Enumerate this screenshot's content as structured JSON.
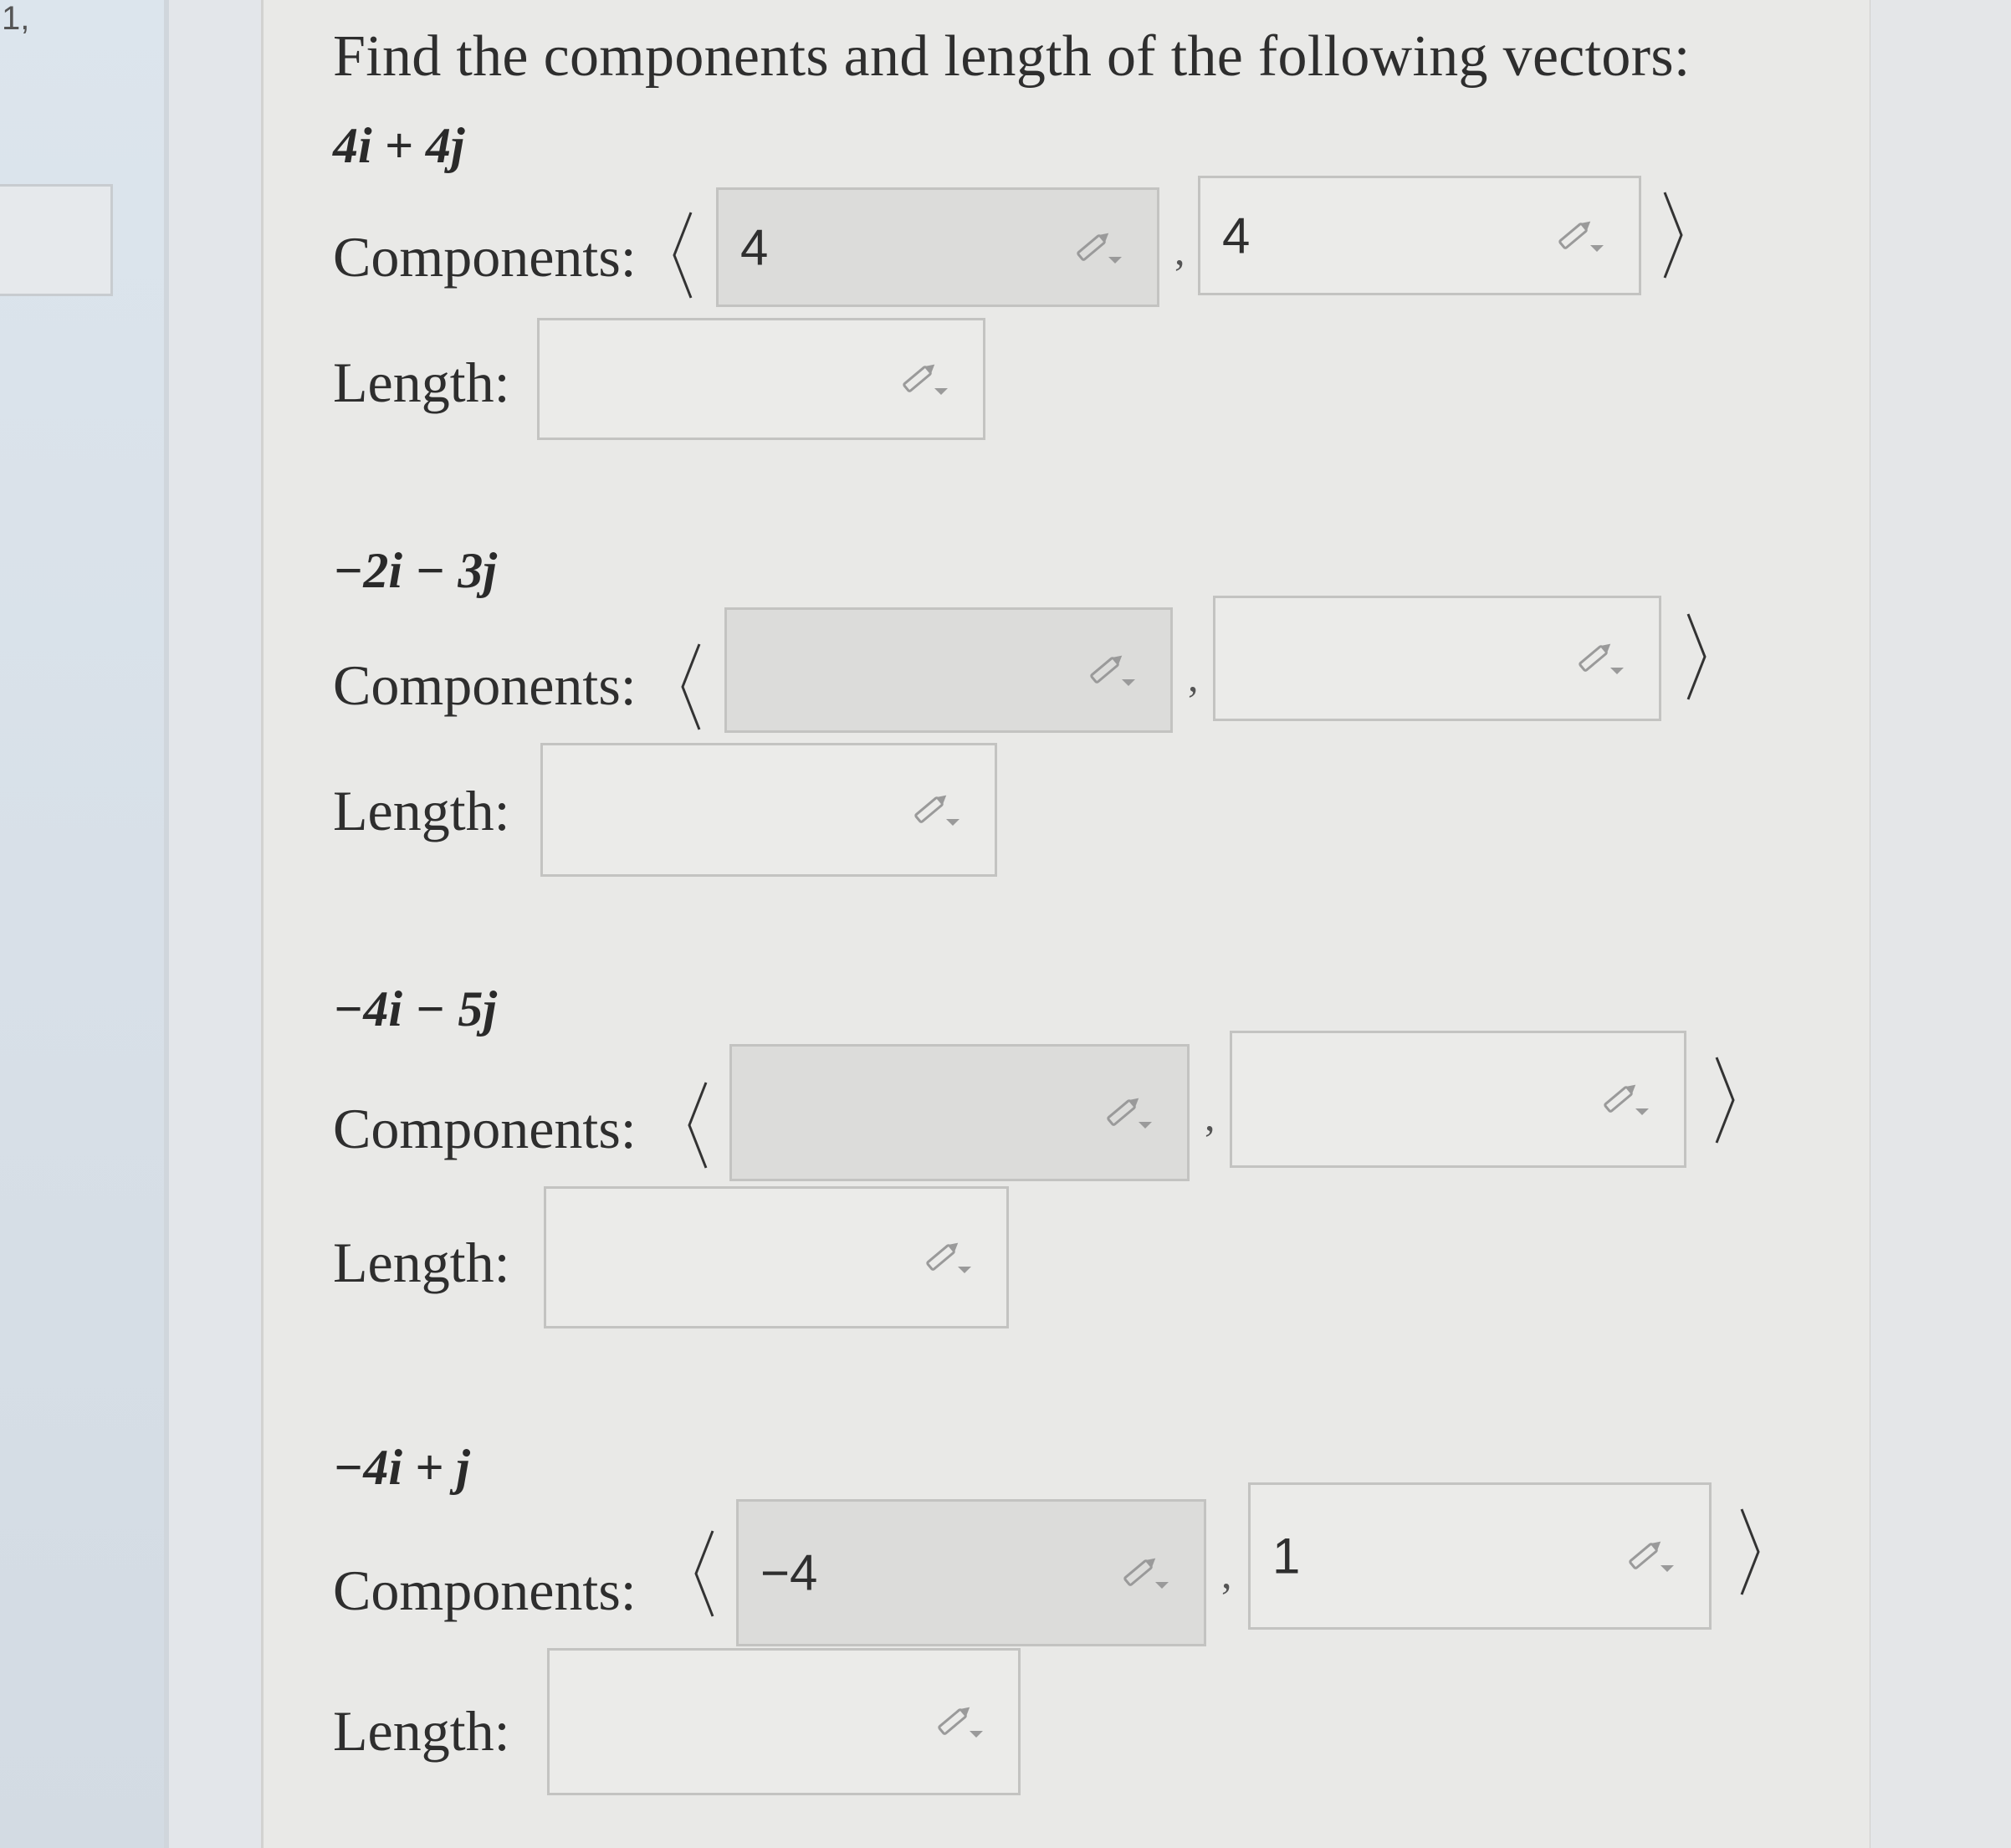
{
  "corner": "1,",
  "instruction": "Find the components and length of the following vectors:",
  "components_label": "Components:",
  "length_label": "Length:",
  "comma": ",",
  "problems": [
    {
      "vector": "4i + 4j",
      "component_1": "4",
      "component_2": "4",
      "length": ""
    },
    {
      "vector": "−2i − 3j",
      "component_1": "",
      "component_2": "",
      "length": ""
    },
    {
      "vector": "−4i − 5j",
      "component_1": "",
      "component_2": "",
      "length": ""
    },
    {
      "vector": "−4i + j",
      "component_1": "−4",
      "component_2": "1",
      "length": ""
    }
  ],
  "icons": {
    "field_edit": "pencil-dropdown-icon"
  }
}
